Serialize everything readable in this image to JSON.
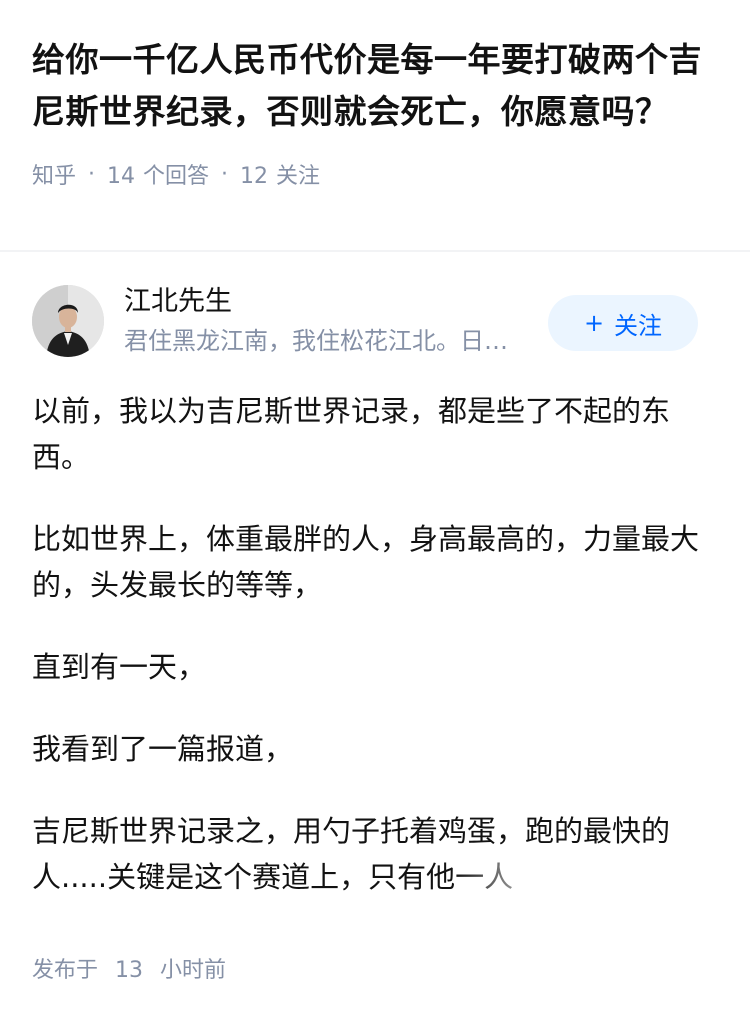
{
  "question": {
    "title": "给你一千亿人民币代价是每一年要打破两个吉尼斯世界纪录，否则就会死亡，你愿意吗？",
    "source": "知乎",
    "answers_count": "14",
    "answers_label": "个回答",
    "followers_count": "12",
    "followers_label": "关注"
  },
  "author": {
    "name": "江北先生",
    "bio": "君住黑龙江南，我住松花江北。日…",
    "follow_label": "关注",
    "follow_icon": "plus-icon"
  },
  "answer": {
    "paragraphs": [
      "以前，我以为吉尼斯世界记录，都是些了不起的东西。",
      "比如世界上，体重最胖的人，身高最高的，力量最大的，头发最长的等等，",
      "直到有一天，",
      "我看到了一篇报道，",
      "吉尼斯世界记录之，用勺子托着鸡蛋，跑的最快的人.....关键是这个赛道上，只有他一人"
    ]
  },
  "published": {
    "label": "发布于",
    "count": "13",
    "unit": "小时前"
  },
  "colors": {
    "accent": "#0066ff",
    "follow_bg": "#ebf5ff",
    "meta_text": "#8590a6",
    "body_text": "#121212"
  }
}
